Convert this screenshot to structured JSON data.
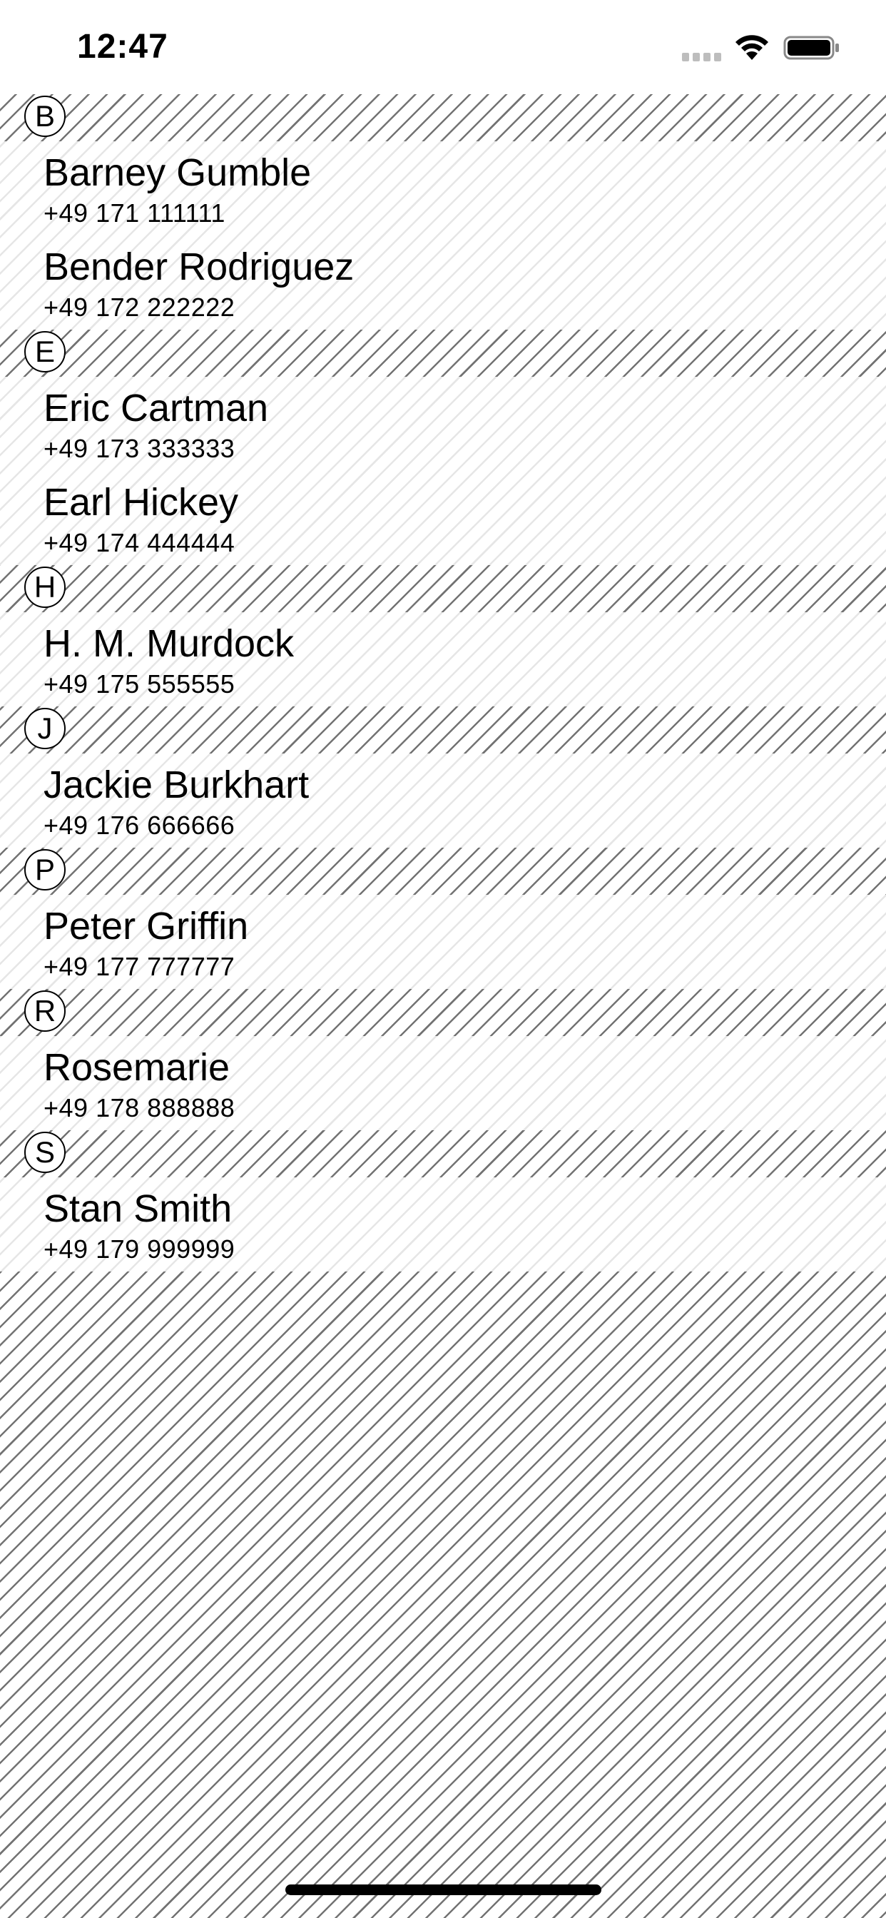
{
  "status_bar": {
    "time": "12:47",
    "icons": [
      "signal-icon",
      "wifi-icon",
      "battery-icon"
    ]
  },
  "sections": [
    {
      "letter": "B",
      "contacts": [
        {
          "name": "Barney Gumble",
          "phone": "+49 171 111111"
        },
        {
          "name": "Bender Rodriguez",
          "phone": "+49 172 222222"
        }
      ]
    },
    {
      "letter": "E",
      "contacts": [
        {
          "name": "Eric Cartman",
          "phone": "+49 173 333333"
        },
        {
          "name": "Earl Hickey",
          "phone": "+49 174 444444"
        }
      ]
    },
    {
      "letter": "H",
      "contacts": [
        {
          "name": "H. M. Murdock",
          "phone": "+49 175 555555"
        }
      ]
    },
    {
      "letter": "J",
      "contacts": [
        {
          "name": "Jackie Burkhart",
          "phone": "+49 176 666666"
        }
      ]
    },
    {
      "letter": "P",
      "contacts": [
        {
          "name": "Peter Griffin",
          "phone": "+49 177 777777"
        }
      ]
    },
    {
      "letter": "R",
      "contacts": [
        {
          "name": "Rosemarie",
          "phone": "+49 178 888888"
        }
      ]
    },
    {
      "letter": "S",
      "contacts": [
        {
          "name": "Stan Smith",
          "phone": "+49 179 999999"
        }
      ]
    }
  ]
}
